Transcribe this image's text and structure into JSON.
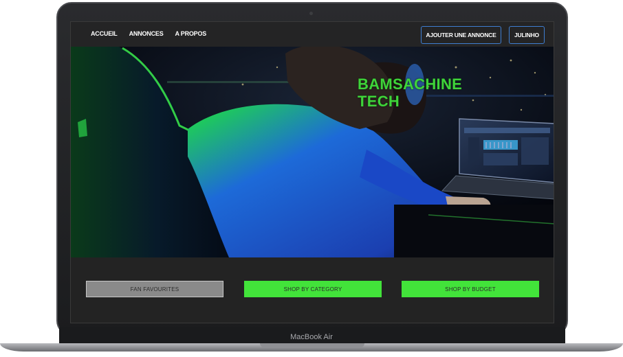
{
  "device": {
    "model_label": "MacBook Air"
  },
  "navbar": {
    "links": [
      {
        "label": "ACCUEIL"
      },
      {
        "label": "ANNONCES"
      },
      {
        "label": "A PROPOS"
      }
    ],
    "add_listing_label": "AJOUTER UNE ANNONCE",
    "user_label": "JULINHO"
  },
  "hero": {
    "title_line1": "BAMSACHINE",
    "title_line2": "TECH",
    "title_color": "#3fd43a"
  },
  "shop_buttons": {
    "fan_favourites": "FAN FAVOURITES",
    "shop_by_category": "SHOP BY CATEGORY",
    "shop_by_budget": "SHOP BY BUDGET"
  },
  "colors": {
    "accent_green": "#42e33a",
    "nav_border_blue": "#3f7fd2",
    "gray_button": "#8a8a8a"
  }
}
